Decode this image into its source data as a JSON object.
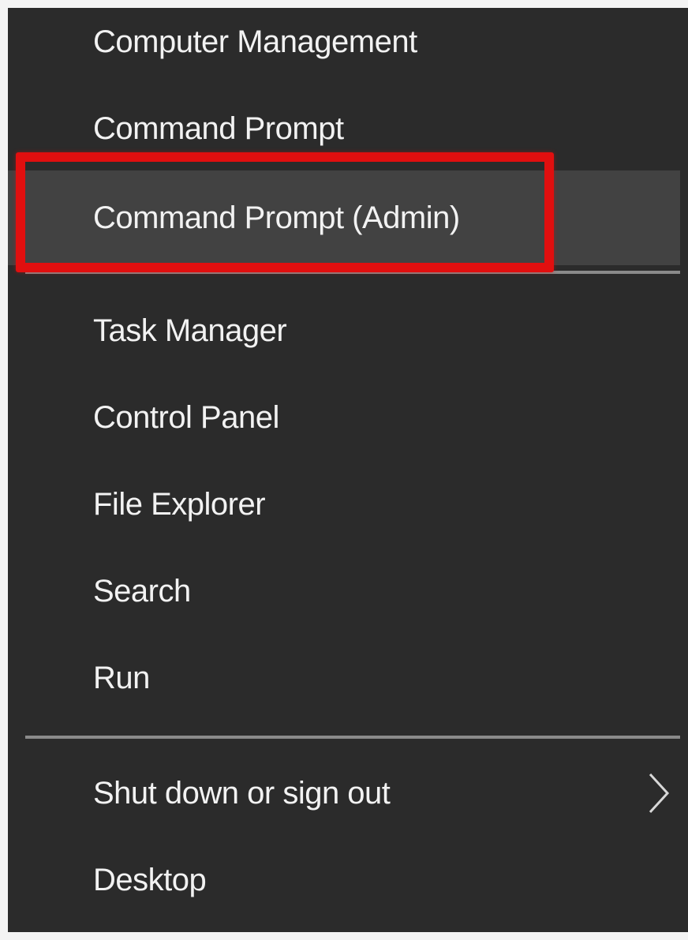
{
  "menu": {
    "items": [
      {
        "label": "Computer Management"
      },
      {
        "label": "Command Prompt"
      },
      {
        "label": "Command Prompt (Admin)"
      },
      {
        "label": "Task Manager"
      },
      {
        "label": "Control Panel"
      },
      {
        "label": "File Explorer"
      },
      {
        "label": "Search"
      },
      {
        "label": "Run"
      },
      {
        "label": "Shut down or sign out"
      },
      {
        "label": "Desktop"
      }
    ],
    "highlighted_item": "Command Prompt (Admin)",
    "highlight_color": "#e10f0f",
    "background_color": "#2b2b2b",
    "hover_color": "#424242",
    "submenu_icon": "chevron-right-icon"
  }
}
